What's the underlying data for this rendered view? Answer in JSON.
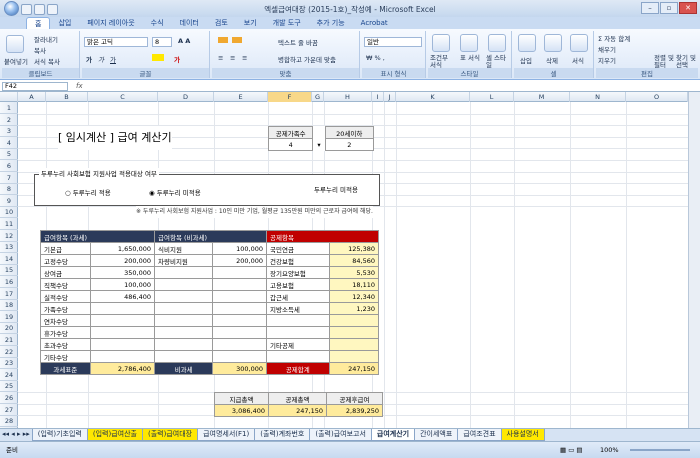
{
  "window": {
    "title": "엑셀급여대장 (2015-1호)_작성예 - Microsoft Excel"
  },
  "ribbon": {
    "tabs": [
      "홈",
      "삽입",
      "페이지 레이아웃",
      "수식",
      "데이터",
      "검토",
      "보기",
      "개발 도구",
      "추가 기능",
      "Acrobat"
    ],
    "clipboard": {
      "paste": "붙여넣기",
      "cut": "잘라내기",
      "copy": "복사",
      "format_painter": "서식 복사",
      "label": "클립보드"
    },
    "font": {
      "name": "맑은 고딕",
      "size": "8",
      "label": "글꼴"
    },
    "align": {
      "wrap": "텍스트 줄 바꿈",
      "merge": "병합하고 가운데 맞춤",
      "label": "맞춤"
    },
    "number": {
      "format": "일반",
      "label": "표시 형식"
    },
    "style": {
      "cond": "조건부 서식",
      "table": "표 서식",
      "cell": "셀 스타일",
      "label": "스타일"
    },
    "cells": {
      "insert": "삽입",
      "delete": "삭제",
      "format": "서식",
      "label": "셀"
    },
    "edit": {
      "autosum": "자동 합계",
      "fill": "채우기",
      "clear": "지우기",
      "sort": "정렬 및 필터",
      "find": "찾기 및 선택",
      "label": "편집"
    }
  },
  "formula": {
    "namebox": "F42",
    "fx": "fx"
  },
  "columns": [
    "A",
    "B",
    "C",
    "D",
    "E",
    "F",
    "G",
    "H",
    "I",
    "J",
    "K",
    "L",
    "M",
    "N",
    "O"
  ],
  "rows": [
    "1",
    "2",
    "3",
    "4",
    "5",
    "6",
    "7",
    "8",
    "9",
    "10",
    "11",
    "12",
    "13",
    "14",
    "15",
    "16",
    "17",
    "18",
    "19",
    "20",
    "21",
    "22",
    "23",
    "24",
    "25",
    "26",
    "27",
    "28"
  ],
  "calc": {
    "title": "[ 임시계산 ]  급여 계산기",
    "dep_label": "공제가족수",
    "dep_value": "4",
    "child_label": "20세이하",
    "child_value": "2",
    "duru_title": "두루누리 사회보험 지원사업 적용대상 여부",
    "radio1": "두루누리 적용",
    "radio2": "두루누리 미적용",
    "duru_status": "두루누리 미적용",
    "note": "※ 두루누리 사회보험 지원사업 : 10인 미만 기업, 월평균 135만원 미만의 근로자 급여에 해당.",
    "taxable_hdr": "급여항목 (과세)",
    "taxable": [
      [
        "기본급",
        "1,650,000"
      ],
      [
        "고정수당",
        "200,000"
      ],
      [
        "상여금",
        "350,000"
      ],
      [
        "직책수당",
        "100,000"
      ],
      [
        "실적수당",
        "486,400"
      ],
      [
        "가족수당",
        ""
      ],
      [
        "연차수당",
        ""
      ],
      [
        "휴가수당",
        ""
      ],
      [
        "초과수당",
        ""
      ],
      [
        "기타수당",
        ""
      ]
    ],
    "nontax_hdr": "급여항목 (비과세)",
    "nontax": [
      [
        "식비지원",
        "100,000"
      ],
      [
        "차량비지원",
        "200,000"
      ]
    ],
    "deduct_hdr": "공제항목",
    "deduct": [
      [
        "국민연금",
        "125,380"
      ],
      [
        "건강보험",
        "84,560"
      ],
      [
        "장기요양보험",
        "5,530"
      ],
      [
        "고용보험",
        "18,110"
      ],
      [
        "갑근세",
        "12,340"
      ],
      [
        "지방소득세",
        "1,230"
      ],
      [
        "",
        ""
      ],
      [
        "",
        ""
      ],
      [
        "기타공제",
        ""
      ],
      [
        "",
        ""
      ]
    ],
    "taxable_total_label": "과세표준",
    "taxable_total": "2,786,400",
    "nontax_total_label": "비과세",
    "nontax_total": "300,000",
    "deduct_total_label": "공제합계",
    "deduct_total": "247,150",
    "sum_hdr": [
      "지급총액",
      "공제총액",
      "공제후급여"
    ],
    "sum_vals": [
      "3,086,400",
      "247,150",
      "2,839,250"
    ]
  },
  "sheettabs": [
    "(입력)기초입력",
    "(입력)급여산출",
    "(출력)급여대장",
    "급여명세서(F1)",
    "(출력)계좌번호",
    "(출력)급여보고서",
    "급여계산기",
    "간이세액표",
    "급여조견표",
    "사용설명서"
  ],
  "status": {
    "ready": "준비",
    "zoom": "100%"
  }
}
